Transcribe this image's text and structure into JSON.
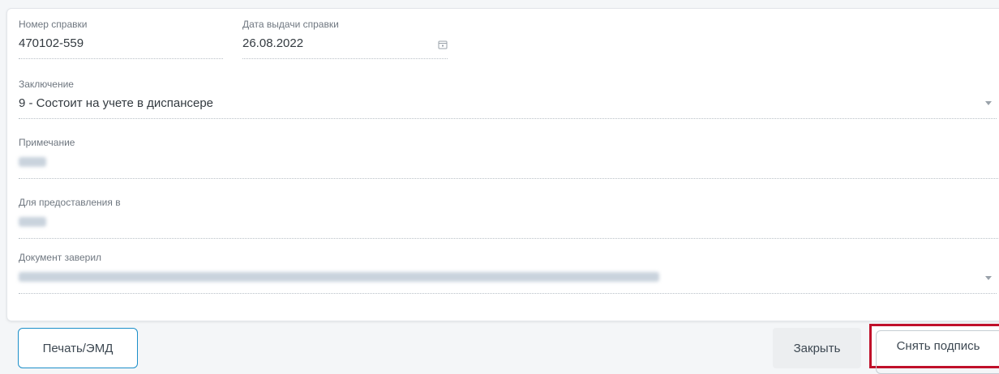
{
  "form": {
    "number": {
      "label": "Номер справки",
      "value": "470102-559"
    },
    "issue_date": {
      "label": "Дата выдачи справки",
      "value": "26.08.2022",
      "icon": "calendar-icon"
    },
    "conclusion": {
      "label": "Заключение",
      "value": "9 - Состоит на учете в диспансере",
      "icon": "chevron-down-icon"
    },
    "note": {
      "label": "Примечание"
    },
    "provide_to": {
      "label": "Для предоставления в"
    },
    "certified_by": {
      "label": "Документ заверил",
      "icon": "chevron-down-icon"
    }
  },
  "footer": {
    "print_label": "Печать/ЭМД",
    "close_label": "Закрыть",
    "unsign_label": "Снять подпись"
  },
  "colors": {
    "accent_border": "#1c8fc9",
    "highlight": "#c0102a"
  }
}
